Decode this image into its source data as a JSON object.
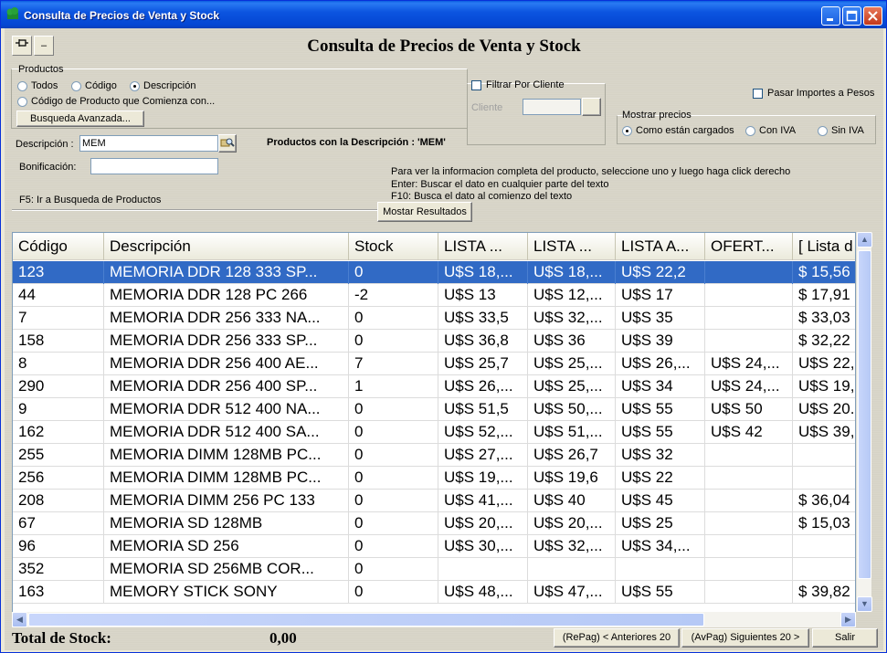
{
  "window": {
    "title": "Consulta de Precios de Venta y Stock"
  },
  "toolbar": {
    "pin_label": "⊣⊐",
    "minus_label": "–"
  },
  "header": {
    "title": "Consulta de Precios de Venta y Stock"
  },
  "productos": {
    "legend": "Productos",
    "todos": "Todos",
    "codigo": "Código",
    "descripcion": "Descripción",
    "codigo_comienza": "Código de Producto que Comienza con...",
    "busqueda_avanzada": "Busqueda Avanzada..."
  },
  "filtro": {
    "filtrar_por_cliente": "Filtrar Por Cliente",
    "cliente_label": "Cliente"
  },
  "pasar_importes": "Pasar Importes a Pesos",
  "mostrar_precios": {
    "legend": "Mostrar precios",
    "como_cargados": "Como están cargados",
    "con_iva": "Con IVA",
    "sin_iva": "Sin IVA"
  },
  "search": {
    "descripcion_label": "Descripción :",
    "descripcion_value": "MEM",
    "bonificacion_label": "Bonificación:",
    "bonificacion_value": "",
    "result_caption": "Productos con la Descripción : 'MEM'",
    "f5_hint": "F5: Ir a Busqueda de Productos"
  },
  "hints": {
    "line1": "Para ver la informacion completa del producto, seleccione uno y luego haga click derecho",
    "line2": "Enter: Buscar el dato en cualquier parte del texto",
    "line3": "F10: Busca el dato al comienzo del texto",
    "mostrar_resultados": "Mostar Resultados"
  },
  "table": {
    "columns": [
      "Código",
      "Descripción",
      "Stock",
      "LISTA ...",
      "LISTA ...",
      "LISTA A...",
      "OFERT...",
      "[ Lista d"
    ],
    "rows": [
      [
        "123",
        "MEMORIA DDR 128 333 SP...",
        "0",
        "U$S 18,...",
        "U$S 18,...",
        "U$S 22,2",
        "",
        "$ 15,56"
      ],
      [
        "44",
        "MEMORIA DDR 128 PC 266",
        "-2",
        "U$S 13",
        "U$S 12,...",
        "U$S 17",
        "",
        "$ 17,91"
      ],
      [
        "7",
        "MEMORIA DDR 256 333 NA...",
        "0",
        "U$S 33,5",
        "U$S 32,...",
        "U$S 35",
        "",
        "$ 33,03"
      ],
      [
        "158",
        "MEMORIA DDR 256 333 SP...",
        "0",
        "U$S 36,8",
        "U$S 36",
        "U$S 39",
        "",
        "$ 32,22"
      ],
      [
        "8",
        "MEMORIA DDR 256 400 AE...",
        "7",
        "U$S 25,7",
        "U$S 25,...",
        "U$S 26,...",
        "U$S 24,...",
        "U$S 22,"
      ],
      [
        "290",
        "MEMORIA DDR 256 400 SP...",
        "1",
        "U$S 26,...",
        "U$S 25,...",
        "U$S 34",
        "U$S 24,...",
        "U$S 19,"
      ],
      [
        "9",
        "MEMORIA DDR 512 400 NA...",
        "0",
        "U$S 51,5",
        "U$S 50,...",
        "U$S 55",
        "U$S 50",
        "U$S 20."
      ],
      [
        "162",
        "MEMORIA DDR 512 400 SA...",
        "0",
        "U$S 52,...",
        "U$S 51,...",
        "U$S 55",
        "U$S 42",
        "U$S 39,"
      ],
      [
        "255",
        "MEMORIA DIMM 128MB PC...",
        "0",
        "U$S 27,...",
        "U$S 26,7",
        "U$S 32",
        "",
        ""
      ],
      [
        "256",
        "MEMORIA DIMM 128MB PC...",
        "0",
        "U$S 19,...",
        "U$S 19,6",
        "U$S 22",
        "",
        ""
      ],
      [
        "208",
        "MEMORIA DIMM 256 PC 133",
        "0",
        "U$S 41,...",
        "U$S 40",
        "U$S 45",
        "",
        "$ 36,04"
      ],
      [
        "67",
        "MEMORIA SD 128MB",
        "0",
        "U$S 20,...",
        "U$S 20,...",
        "U$S 25",
        "",
        "$ 15,03"
      ],
      [
        "96",
        "MEMORIA SD 256",
        "0",
        "U$S 30,...",
        "U$S 32,...",
        "U$S 34,...",
        "",
        ""
      ],
      [
        "352",
        "MEMORIA SD 256MB COR...",
        "0",
        "",
        "",
        "",
        "",
        ""
      ],
      [
        "163",
        "MEMORY STICK SONY",
        "0",
        "U$S 48,...",
        "U$S 47,...",
        "U$S 55",
        "",
        "$ 39,82"
      ]
    ]
  },
  "footer": {
    "total_label": "Total de Stock:",
    "total_value": "0,00",
    "anteriores": "(RePag) < Anteriores 20",
    "siguientes": "(AvPag) Siguientes 20 >",
    "salir": "Salir"
  },
  "colors": {
    "selection": "#316ac5",
    "titlebar": "#0c55e0"
  }
}
